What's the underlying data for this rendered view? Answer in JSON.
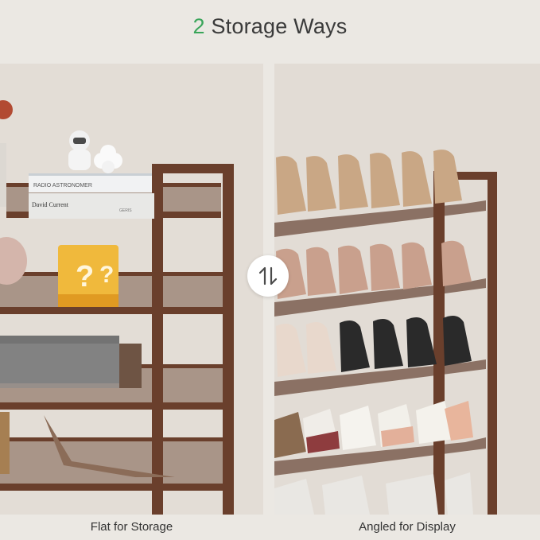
{
  "heading": {
    "number": "2",
    "text": " Storage Ways"
  },
  "left_panel": {
    "caption": "Flat for Storage",
    "book_top_title": "RADIO ASTRONOMER",
    "book_bottom_title": "David Current",
    "book_bottom_brand": "GERIS"
  },
  "right_panel": {
    "caption": "Angled for Display"
  },
  "swap_icon": "up-down-arrows-icon",
  "colors": {
    "accent": "#3aa55a",
    "frame": "#6a3f2c",
    "background": "#e3ddd6"
  }
}
